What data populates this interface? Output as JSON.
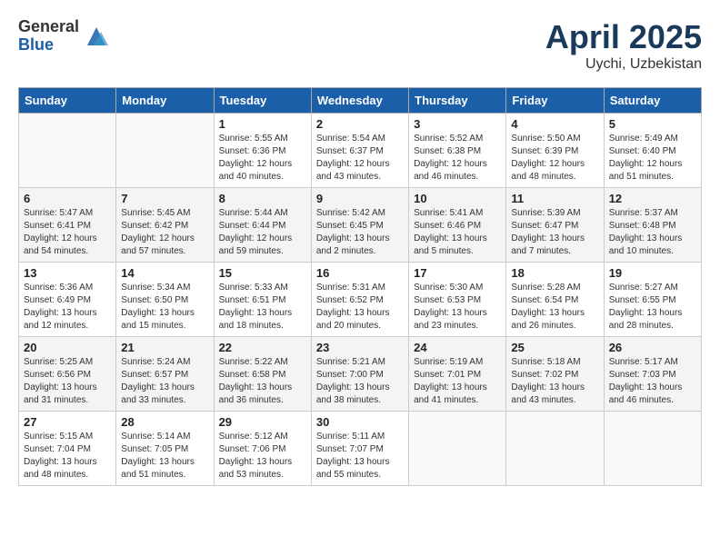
{
  "header": {
    "logo_general": "General",
    "logo_blue": "Blue",
    "month": "April 2025",
    "location": "Uychi, Uzbekistan"
  },
  "days_of_week": [
    "Sunday",
    "Monday",
    "Tuesday",
    "Wednesday",
    "Thursday",
    "Friday",
    "Saturday"
  ],
  "weeks": [
    [
      {
        "day": "",
        "sunrise": "",
        "sunset": "",
        "daylight": ""
      },
      {
        "day": "",
        "sunrise": "",
        "sunset": "",
        "daylight": ""
      },
      {
        "day": "1",
        "sunrise": "Sunrise: 5:55 AM",
        "sunset": "Sunset: 6:36 PM",
        "daylight": "Daylight: 12 hours and 40 minutes."
      },
      {
        "day": "2",
        "sunrise": "Sunrise: 5:54 AM",
        "sunset": "Sunset: 6:37 PM",
        "daylight": "Daylight: 12 hours and 43 minutes."
      },
      {
        "day": "3",
        "sunrise": "Sunrise: 5:52 AM",
        "sunset": "Sunset: 6:38 PM",
        "daylight": "Daylight: 12 hours and 46 minutes."
      },
      {
        "day": "4",
        "sunrise": "Sunrise: 5:50 AM",
        "sunset": "Sunset: 6:39 PM",
        "daylight": "Daylight: 12 hours and 48 minutes."
      },
      {
        "day": "5",
        "sunrise": "Sunrise: 5:49 AM",
        "sunset": "Sunset: 6:40 PM",
        "daylight": "Daylight: 12 hours and 51 minutes."
      }
    ],
    [
      {
        "day": "6",
        "sunrise": "Sunrise: 5:47 AM",
        "sunset": "Sunset: 6:41 PM",
        "daylight": "Daylight: 12 hours and 54 minutes."
      },
      {
        "day": "7",
        "sunrise": "Sunrise: 5:45 AM",
        "sunset": "Sunset: 6:42 PM",
        "daylight": "Daylight: 12 hours and 57 minutes."
      },
      {
        "day": "8",
        "sunrise": "Sunrise: 5:44 AM",
        "sunset": "Sunset: 6:44 PM",
        "daylight": "Daylight: 12 hours and 59 minutes."
      },
      {
        "day": "9",
        "sunrise": "Sunrise: 5:42 AM",
        "sunset": "Sunset: 6:45 PM",
        "daylight": "Daylight: 13 hours and 2 minutes."
      },
      {
        "day": "10",
        "sunrise": "Sunrise: 5:41 AM",
        "sunset": "Sunset: 6:46 PM",
        "daylight": "Daylight: 13 hours and 5 minutes."
      },
      {
        "day": "11",
        "sunrise": "Sunrise: 5:39 AM",
        "sunset": "Sunset: 6:47 PM",
        "daylight": "Daylight: 13 hours and 7 minutes."
      },
      {
        "day": "12",
        "sunrise": "Sunrise: 5:37 AM",
        "sunset": "Sunset: 6:48 PM",
        "daylight": "Daylight: 13 hours and 10 minutes."
      }
    ],
    [
      {
        "day": "13",
        "sunrise": "Sunrise: 5:36 AM",
        "sunset": "Sunset: 6:49 PM",
        "daylight": "Daylight: 13 hours and 12 minutes."
      },
      {
        "day": "14",
        "sunrise": "Sunrise: 5:34 AM",
        "sunset": "Sunset: 6:50 PM",
        "daylight": "Daylight: 13 hours and 15 minutes."
      },
      {
        "day": "15",
        "sunrise": "Sunrise: 5:33 AM",
        "sunset": "Sunset: 6:51 PM",
        "daylight": "Daylight: 13 hours and 18 minutes."
      },
      {
        "day": "16",
        "sunrise": "Sunrise: 5:31 AM",
        "sunset": "Sunset: 6:52 PM",
        "daylight": "Daylight: 13 hours and 20 minutes."
      },
      {
        "day": "17",
        "sunrise": "Sunrise: 5:30 AM",
        "sunset": "Sunset: 6:53 PM",
        "daylight": "Daylight: 13 hours and 23 minutes."
      },
      {
        "day": "18",
        "sunrise": "Sunrise: 5:28 AM",
        "sunset": "Sunset: 6:54 PM",
        "daylight": "Daylight: 13 hours and 26 minutes."
      },
      {
        "day": "19",
        "sunrise": "Sunrise: 5:27 AM",
        "sunset": "Sunset: 6:55 PM",
        "daylight": "Daylight: 13 hours and 28 minutes."
      }
    ],
    [
      {
        "day": "20",
        "sunrise": "Sunrise: 5:25 AM",
        "sunset": "Sunset: 6:56 PM",
        "daylight": "Daylight: 13 hours and 31 minutes."
      },
      {
        "day": "21",
        "sunrise": "Sunrise: 5:24 AM",
        "sunset": "Sunset: 6:57 PM",
        "daylight": "Daylight: 13 hours and 33 minutes."
      },
      {
        "day": "22",
        "sunrise": "Sunrise: 5:22 AM",
        "sunset": "Sunset: 6:58 PM",
        "daylight": "Daylight: 13 hours and 36 minutes."
      },
      {
        "day": "23",
        "sunrise": "Sunrise: 5:21 AM",
        "sunset": "Sunset: 7:00 PM",
        "daylight": "Daylight: 13 hours and 38 minutes."
      },
      {
        "day": "24",
        "sunrise": "Sunrise: 5:19 AM",
        "sunset": "Sunset: 7:01 PM",
        "daylight": "Daylight: 13 hours and 41 minutes."
      },
      {
        "day": "25",
        "sunrise": "Sunrise: 5:18 AM",
        "sunset": "Sunset: 7:02 PM",
        "daylight": "Daylight: 13 hours and 43 minutes."
      },
      {
        "day": "26",
        "sunrise": "Sunrise: 5:17 AM",
        "sunset": "Sunset: 7:03 PM",
        "daylight": "Daylight: 13 hours and 46 minutes."
      }
    ],
    [
      {
        "day": "27",
        "sunrise": "Sunrise: 5:15 AM",
        "sunset": "Sunset: 7:04 PM",
        "daylight": "Daylight: 13 hours and 48 minutes."
      },
      {
        "day": "28",
        "sunrise": "Sunrise: 5:14 AM",
        "sunset": "Sunset: 7:05 PM",
        "daylight": "Daylight: 13 hours and 51 minutes."
      },
      {
        "day": "29",
        "sunrise": "Sunrise: 5:12 AM",
        "sunset": "Sunset: 7:06 PM",
        "daylight": "Daylight: 13 hours and 53 minutes."
      },
      {
        "day": "30",
        "sunrise": "Sunrise: 5:11 AM",
        "sunset": "Sunset: 7:07 PM",
        "daylight": "Daylight: 13 hours and 55 minutes."
      },
      {
        "day": "",
        "sunrise": "",
        "sunset": "",
        "daylight": ""
      },
      {
        "day": "",
        "sunrise": "",
        "sunset": "",
        "daylight": ""
      },
      {
        "day": "",
        "sunrise": "",
        "sunset": "",
        "daylight": ""
      }
    ]
  ]
}
